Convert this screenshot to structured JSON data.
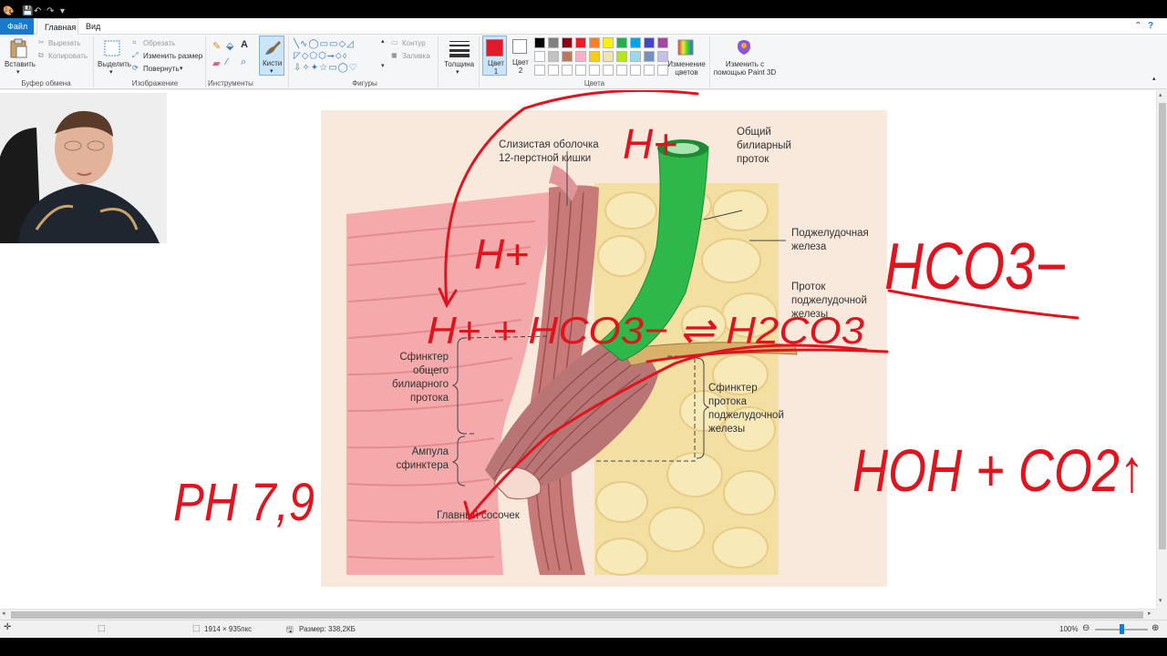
{
  "window": {
    "tabs": {
      "file": "Файл",
      "home": "Главная",
      "view": "Вид"
    },
    "controls": {
      "help": "?"
    }
  },
  "ribbon": {
    "clipboard": {
      "label": "Буфер обмена",
      "paste": "Вставить",
      "cut": "Вырезать",
      "copy": "Копировать"
    },
    "image": {
      "label": "Изображение",
      "select": "Выделить",
      "crop": "Обрезать",
      "resize": "Изменить размер",
      "rotate": "Повернуть"
    },
    "tools": {
      "label": "Инструменты"
    },
    "brushes": {
      "label": "Кисти"
    },
    "shapes": {
      "label": "Фигуры",
      "outline": "Контур",
      "fill": "Заливка"
    },
    "size": {
      "label": "Толщина"
    },
    "colors": {
      "label": "Цвета",
      "color1": "Цвет 1",
      "color2": "Цвет 2",
      "edit": "Изменение цветов",
      "paint3d": "Изменить с помощью Paint 3D",
      "palette_row1": [
        "#000000",
        "#7f7f7f",
        "#880015",
        "#ed1c24",
        "#ff7f27",
        "#fff200",
        "#22b14c",
        "#00a2e8",
        "#3f48cc",
        "#a349a4"
      ],
      "palette_row2": [
        "#ffffff",
        "#c3c3c3",
        "#b97a57",
        "#ffaec9",
        "#ffc90e",
        "#efe4b0",
        "#b5e61d",
        "#99d9ea",
        "#7092be",
        "#c8bfe7"
      ],
      "active_color1": "#e01a2b",
      "active_color2": "#ffffff"
    }
  },
  "status": {
    "dimensions": "1914 × 935пкс",
    "filesize": "Размер: 338,2КБ",
    "zoom": "100%",
    "zoom_level": 0.5
  },
  "figure": {
    "labels": {
      "mucosa": [
        "Слизистая оболочка",
        "12-перстной кишки"
      ],
      "bile_duct": [
        "Общий",
        "билиарный",
        "проток"
      ],
      "pancreas": [
        "Поджелудочная",
        "железа"
      ],
      "pancreatic_duct": [
        "Проток",
        "поджелудочной",
        "железы"
      ],
      "bile_sphincter": [
        "Сфинктер",
        "общего",
        "билиарного",
        "протока"
      ],
      "pancreatic_sphincter": [
        "Сфинктер",
        "протока",
        "поджелудочной",
        "железы"
      ],
      "ampulla": [
        "Ампула",
        "сфинктера"
      ],
      "papilla": "Главный сосочек"
    }
  },
  "handwriting": {
    "h_top": "H+",
    "h_mid": "H+",
    "equation": "H+ + HCO3− ⇌ H2CO3",
    "bicarbonate": "HCO3−",
    "water_co2": "HOH + CO2↑",
    "ph": "PH 7,9"
  },
  "accent": {
    "ink": "#e0141e",
    "bile_green": "#2fb84a",
    "tab_blue": "#1979ca"
  }
}
